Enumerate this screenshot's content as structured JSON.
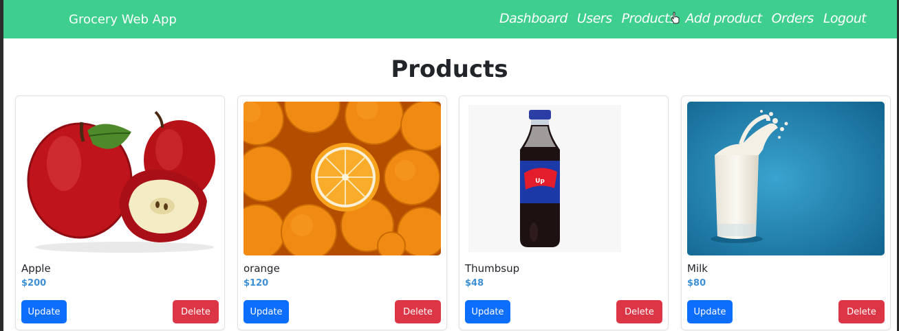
{
  "nav": {
    "brand": "Grocery Web App",
    "links": [
      "Dashboard",
      "Users",
      "Products",
      "Add product",
      "Orders",
      "Logout"
    ]
  },
  "page": {
    "title": "Products"
  },
  "products": [
    {
      "name": "Apple",
      "price": "$200",
      "update_label": "Update",
      "delete_label": "Delete",
      "image_icon": "apple-image"
    },
    {
      "name": "orange",
      "price": "$120",
      "update_label": "Update",
      "delete_label": "Delete",
      "image_icon": "orange-image"
    },
    {
      "name": "Thumbsup",
      "price": "$48",
      "update_label": "Update",
      "delete_label": "Delete",
      "image_icon": "cola-bottle-image"
    },
    {
      "name": "Milk",
      "price": "$80",
      "update_label": "Update",
      "delete_label": "Delete",
      "image_icon": "milk-glass-image"
    }
  ],
  "colors": {
    "navbar": "#3ecf8e",
    "update_button": "#0d6efd",
    "delete_button": "#dc3545",
    "price_text": "#3d8fd6"
  }
}
